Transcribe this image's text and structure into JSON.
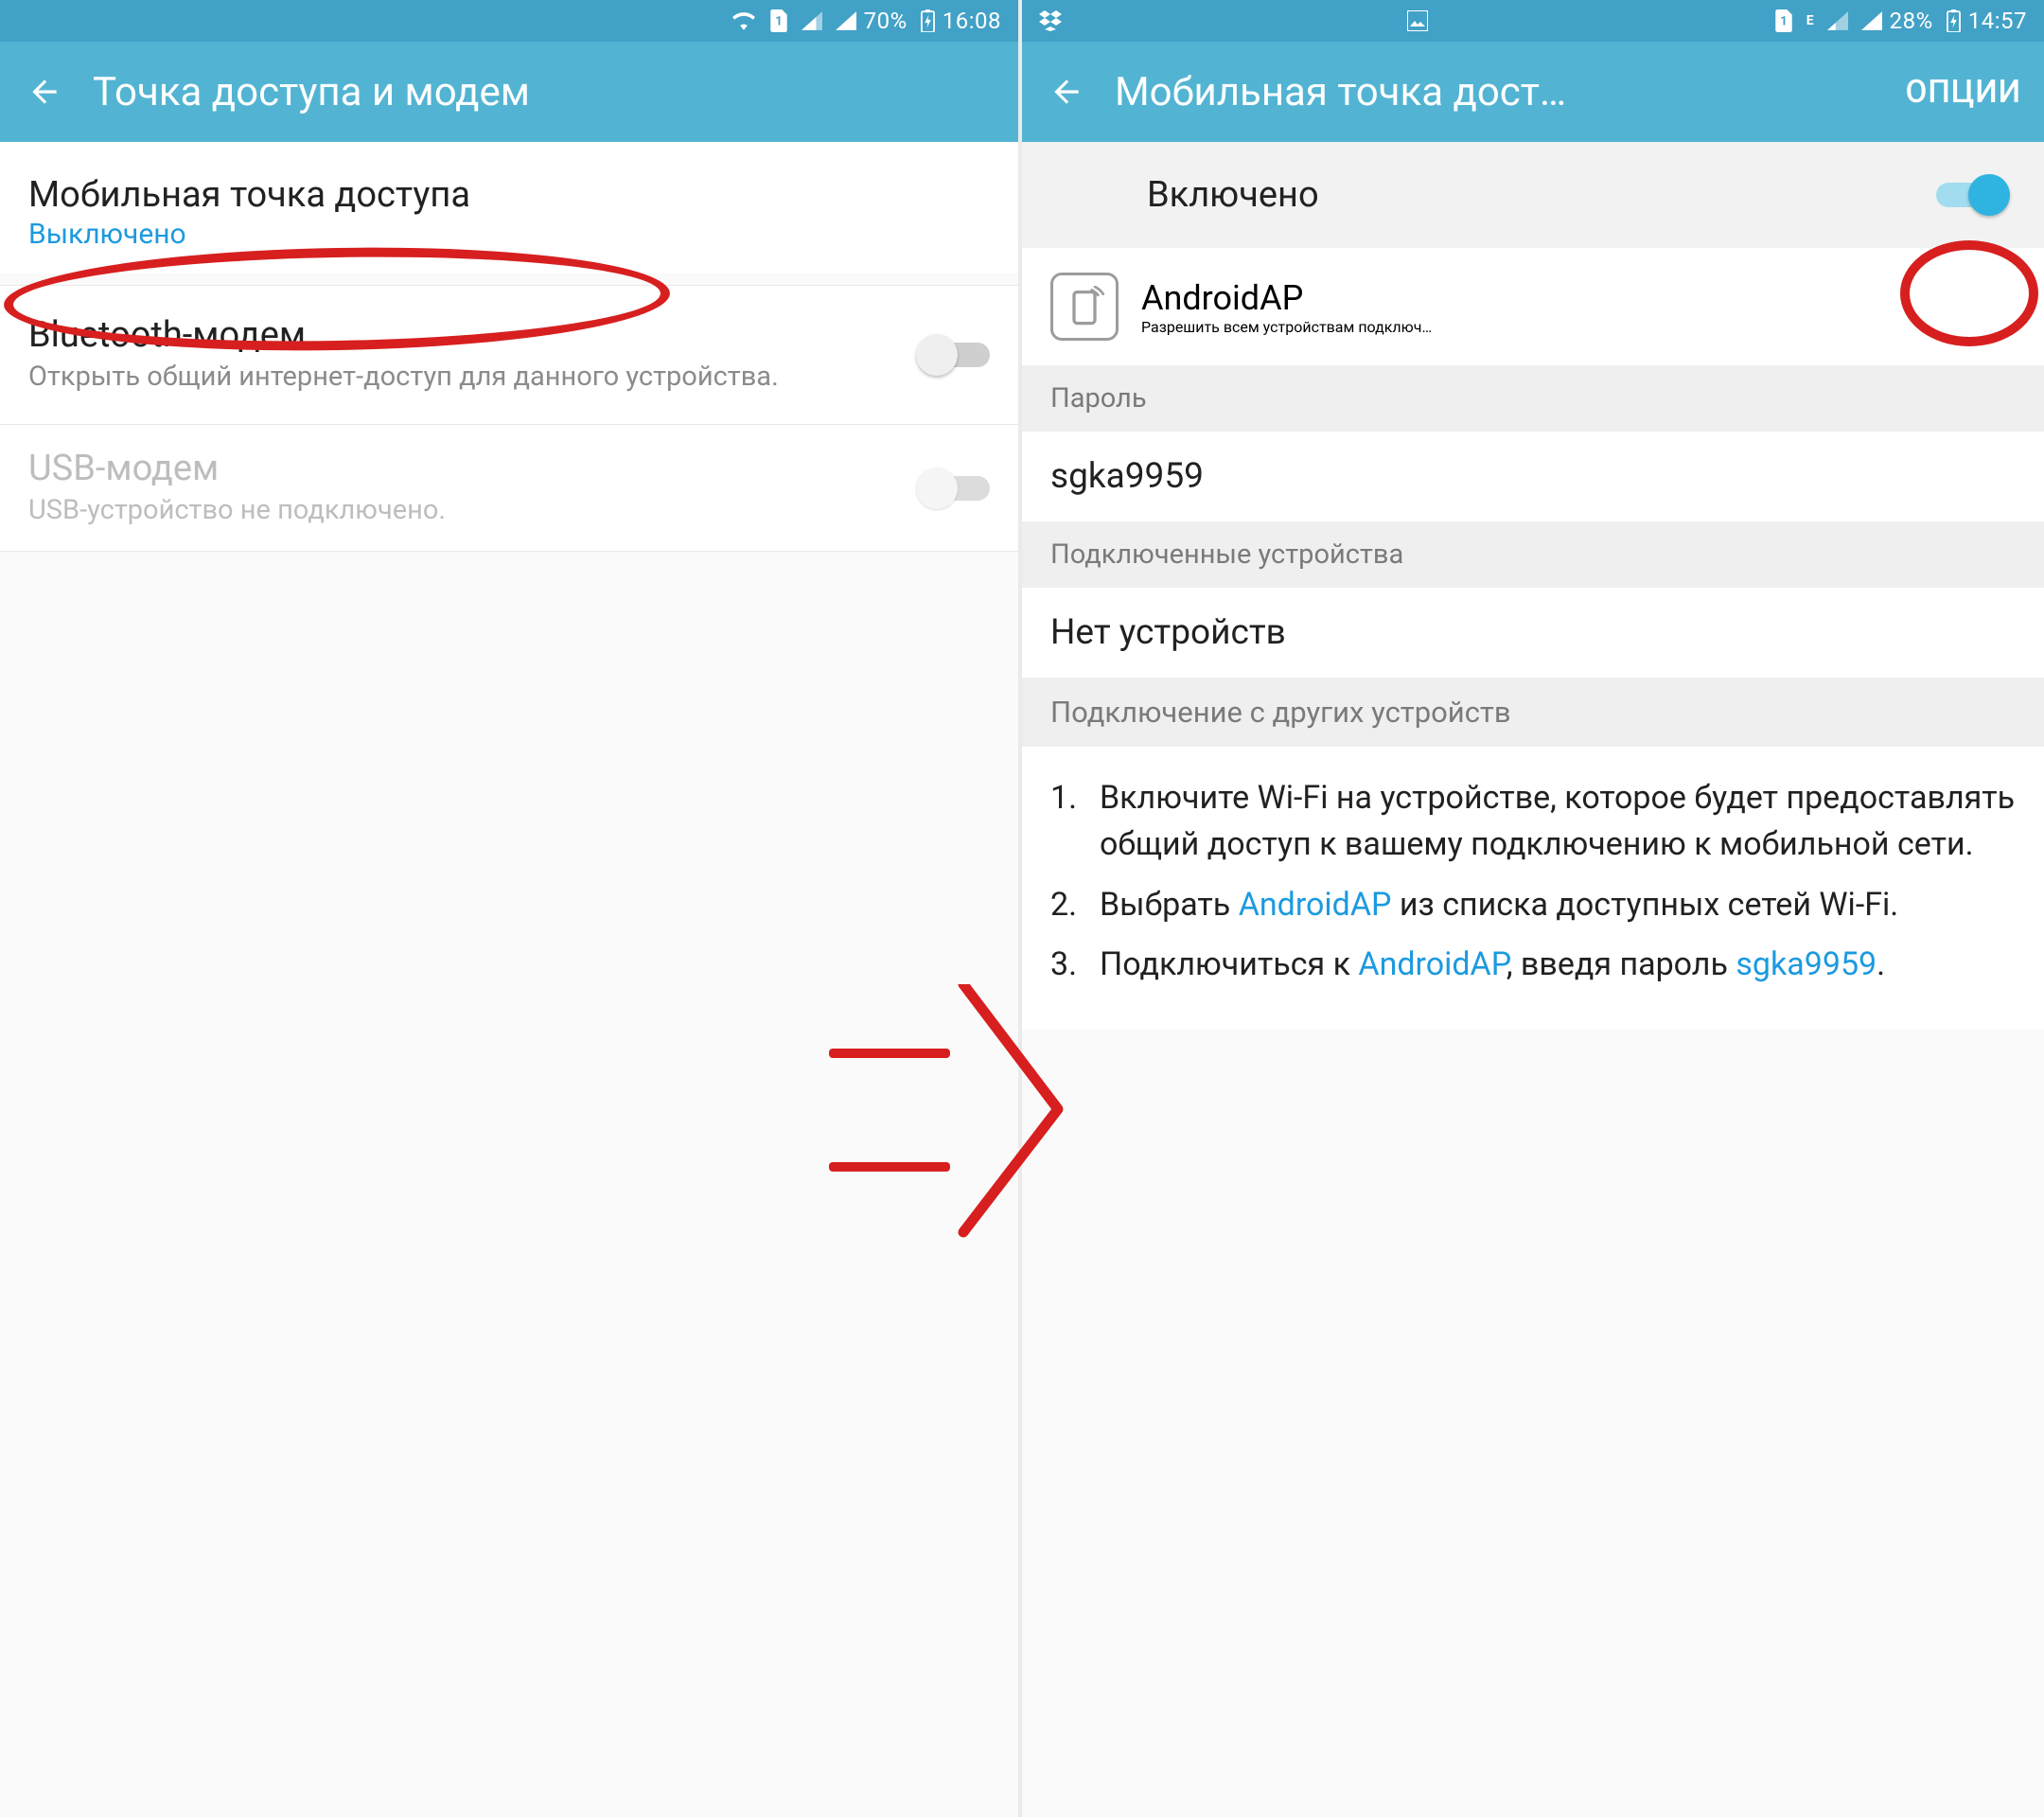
{
  "left": {
    "status": {
      "battery": "70%",
      "time": "16:08"
    },
    "appbar_title": "Точка доступа и модем",
    "hotspot": {
      "title": "Мобильная точка доступа",
      "status": "Выключено"
    },
    "bt": {
      "title": "Bluetooth-модем",
      "desc": "Открыть общий интернет-доступ для данного устройства."
    },
    "usb": {
      "title": "USB-модем",
      "desc": "USB-устройство не подключено."
    }
  },
  "right": {
    "status": {
      "battery": "28%",
      "time": "14:57"
    },
    "appbar_title": "Мобильная точка дост…",
    "options_label": "ОПЦИИ",
    "enabled_label": "Включено",
    "ap": {
      "name": "AndroidAP",
      "subtitle": "Разрешить всем устройствам подключ…"
    },
    "password_hdr": "Пароль",
    "password": "sgka9959",
    "connected_hdr": "Подключенные устройства",
    "connected_value": "Нет устройств",
    "howto_hdr": "Подключение с других устройств",
    "steps": {
      "s1": "Включите Wi-Fi на устройстве, которое будет предоставлять общий доступ к вашему подключению к мобильной сети.",
      "s2a": "Выбрать ",
      "s2b": " из списка доступных сетей Wi-Fi.",
      "s3a": "Подключиться к ",
      "s3b": ", введя пароль ",
      "s3c": "."
    }
  },
  "colors": {
    "accent": "#2fb3e0",
    "link": "#1c9adf",
    "red": "#d71f1f"
  }
}
